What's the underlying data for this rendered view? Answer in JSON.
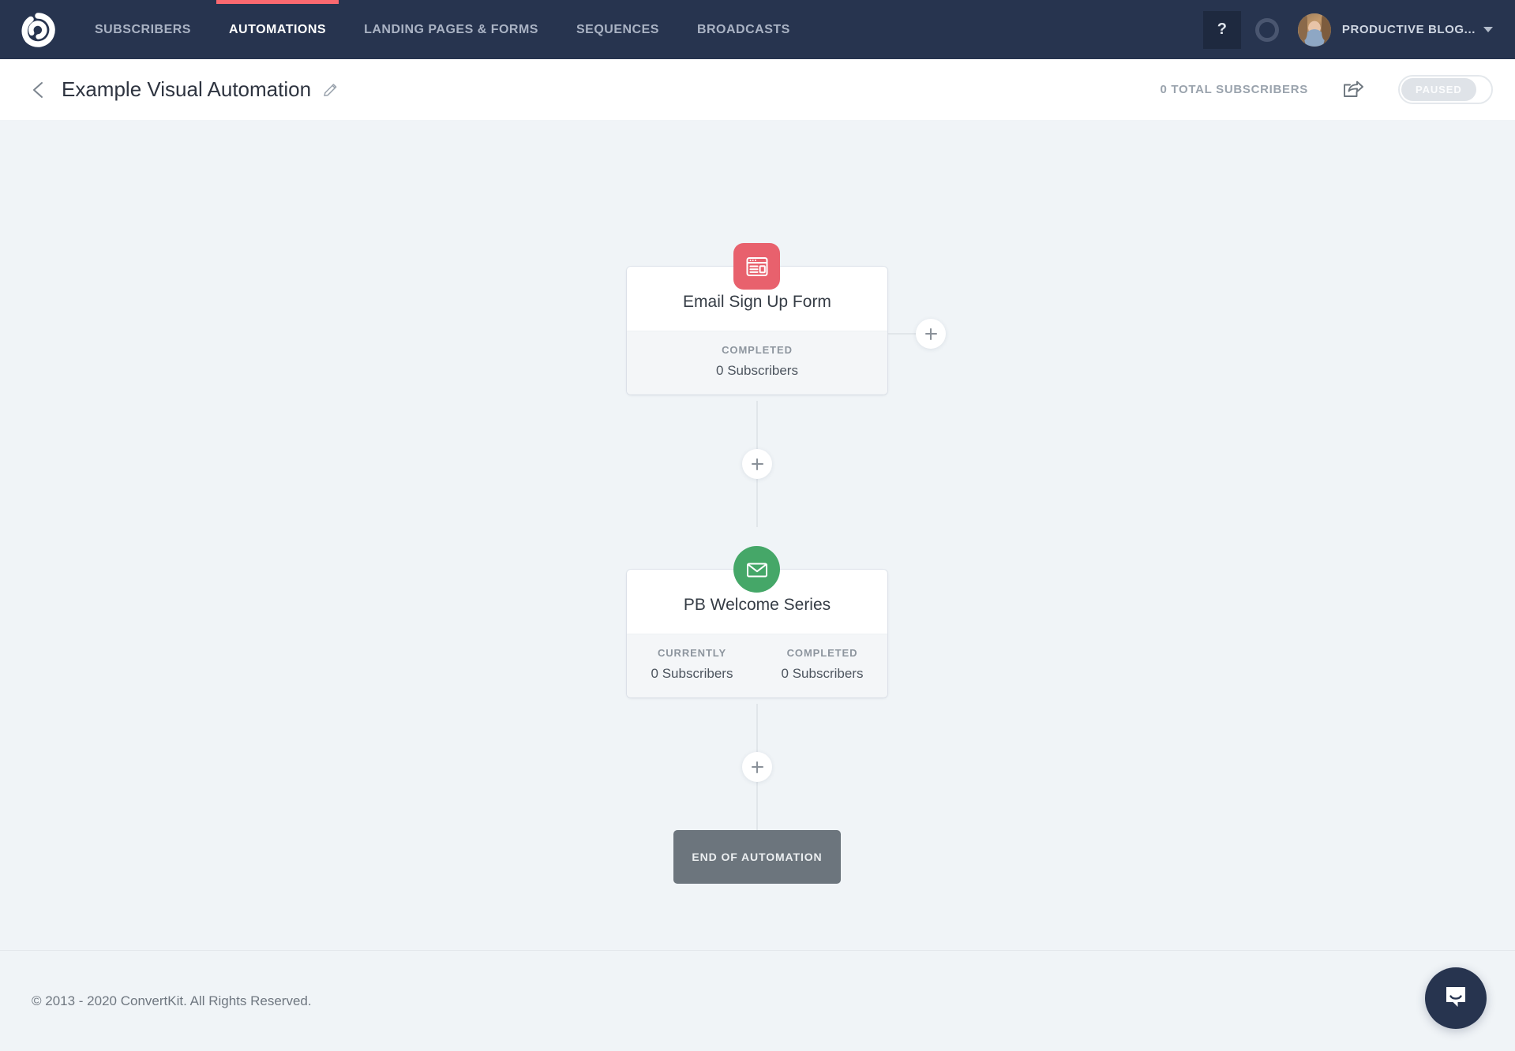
{
  "topnav": {
    "logo_icon": "convertkit-logo-icon",
    "items": [
      {
        "label": "SUBSCRIBERS",
        "active": false
      },
      {
        "label": "AUTOMATIONS",
        "active": true
      },
      {
        "label": "LANDING PAGES & FORMS",
        "active": false
      },
      {
        "label": "SEQUENCES",
        "active": false
      },
      {
        "label": "BROADCASTS",
        "active": false
      }
    ],
    "help_label": "?",
    "status_ring_icon": "circle-ring-icon",
    "avatar_icon": "user-avatar",
    "account_name": "PRODUCTIVE BLOG...",
    "caret_icon": "chevron-down-icon",
    "accent_color": "#fb6970",
    "background_color": "#27344f"
  },
  "subheader": {
    "back_icon": "chevron-left-icon",
    "title": "Example Visual Automation",
    "edit_icon": "pencil-icon",
    "total_subscribers": "0 TOTAL SUBSCRIBERS",
    "share_icon": "share-icon",
    "toggle_label": "PAUSED",
    "toggle_state": "off"
  },
  "canvas": {
    "nodes": [
      {
        "id": "email-sign-up-form",
        "icon": "form-icon",
        "icon_color": "#e8616d",
        "title": "Email Sign Up Form",
        "stats": [
          {
            "label": "COMPLETED",
            "value": "0 Subscribers"
          }
        ]
      },
      {
        "id": "pb-welcome-series",
        "icon": "envelope-icon",
        "icon_color": "#45a768",
        "title": "PB Welcome Series",
        "stats": [
          {
            "label": "CURRENTLY",
            "value": "0 Subscribers"
          },
          {
            "label": "COMPLETED",
            "value": "0 Subscribers"
          }
        ]
      }
    ],
    "add_step_icon": "plus-icon",
    "end_label": "END OF AUTOMATION"
  },
  "footer": {
    "copyright": "© 2013 - 2020 ConvertKit. All Rights Reserved.",
    "chat_icon": "intercom-chat-icon"
  }
}
